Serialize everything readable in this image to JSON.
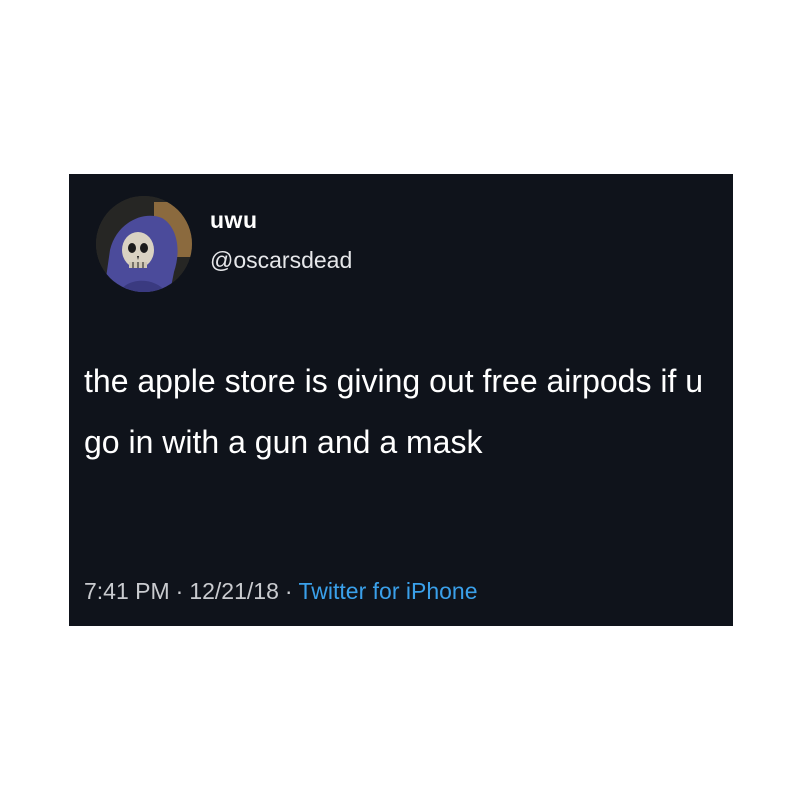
{
  "tweet": {
    "display_name": "uwu",
    "handle": "@oscarsdead",
    "text": "the apple store is giving out free airpods if u go in with a gun and a mask",
    "time": "7:41 PM",
    "date": "12/21/18",
    "separator": "·",
    "source": "Twitter for iPhone"
  },
  "avatar": {
    "icon": "hooded-skull-avatar"
  },
  "colors": {
    "card_background": "#0f131b",
    "text_primary": "#ffffff",
    "text_secondary": "#c9cbcf",
    "source_link": "#3aa0ea",
    "hood_purple": "#4b4b9b"
  }
}
